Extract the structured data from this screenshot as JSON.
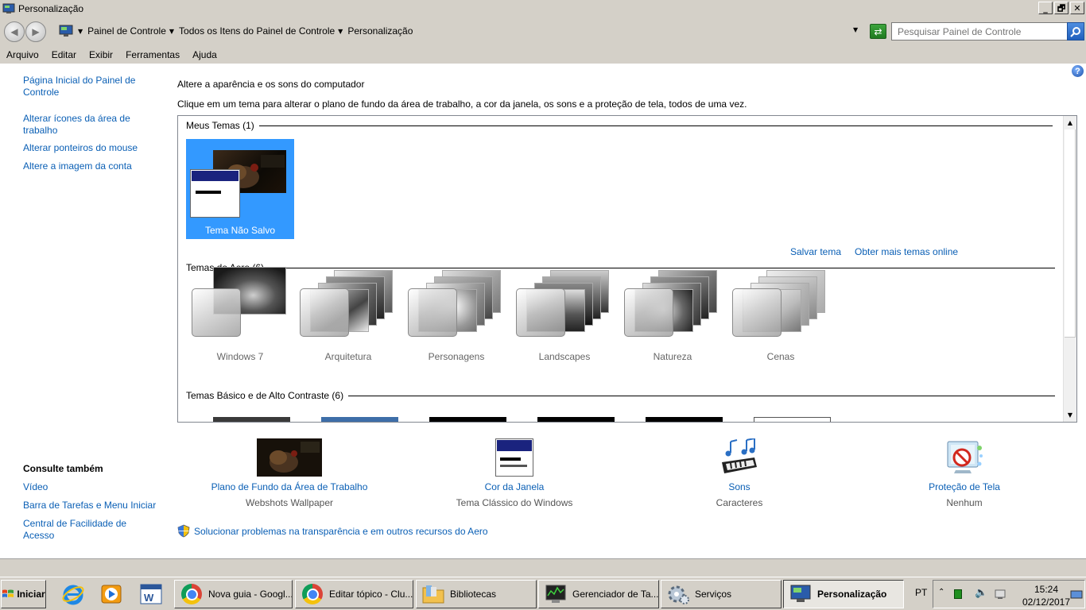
{
  "window": {
    "title": "Personalização",
    "minimize": "_",
    "maximize": "🗗",
    "close": "✕"
  },
  "address": {
    "crumbs": [
      "Painel de Controle",
      "Todos os Itens do Painel de Controle",
      "Personalização"
    ],
    "search_placeholder": "Pesquisar Painel de Controle"
  },
  "menu": [
    "Arquivo",
    "Editar",
    "Exibir",
    "Ferramentas",
    "Ajuda"
  ],
  "sidebar": {
    "links": [
      "Página Inicial do Painel de Controle",
      "Alterar ícones da área de trabalho",
      "Alterar ponteiros do mouse",
      "Altere a imagem da conta"
    ],
    "see_also_title": "Consulte também",
    "see_also": [
      "Vídeo",
      "Barra de Tarefas e Menu Iniciar",
      "Central de Facilidade de Acesso"
    ]
  },
  "main": {
    "heading": "Altere a aparência e os sons do computador",
    "subheading": "Clique em um tema para alterar o plano de fundo da área de trabalho, a cor da janela, os sons e a proteção de tela, todos de uma vez.",
    "my_themes_title": "Meus Temas (1)",
    "my_theme_label": "Tema Não Salvo",
    "save_theme": "Salvar tema",
    "more_themes": "Obter mais temas online",
    "aero_title": "Temas do Aero (6)",
    "aero_themes": [
      "Windows 7",
      "Arquitetura",
      "Personagens",
      "Landscapes",
      "Natureza",
      "Cenas"
    ],
    "basic_title": "Temas Básico e de Alto Contraste (6)"
  },
  "bottom": {
    "items": [
      {
        "label": "Plano de Fundo da Área de Trabalho",
        "value": "Webshots Wallpaper"
      },
      {
        "label": "Cor da Janela",
        "value": "Tema Clássico do Windows"
      },
      {
        "label": "Sons",
        "value": "Caracteres"
      },
      {
        "label": "Proteção de Tela",
        "value": "Nenhum"
      }
    ],
    "aero_link": "Solucionar problemas na transparência e em outros recursos do Aero"
  },
  "taskbar": {
    "start": "Iniciar",
    "tasks": [
      "Nova guia - Googl...",
      "Editar tópico - Clu...",
      "Bibliotecas",
      "Gerenciador de Ta...",
      "Serviços",
      "Personalização"
    ],
    "lang": "PT",
    "time": "15:24",
    "date": "02/12/2017"
  }
}
